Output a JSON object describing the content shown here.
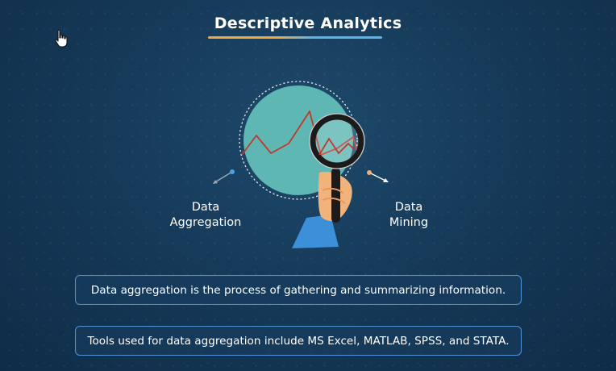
{
  "slide": {
    "title": "Descriptive Analytics",
    "label_left": "Data\nAggregation",
    "label_left_line1": "Data",
    "label_left_line2": "Aggregation",
    "label_right_line1": "Data",
    "label_right_line2": "Mining",
    "info_1": "Data aggregation is the process of gathering and summarizing information.",
    "info_2": "Tools used for data aggregation include MS Excel, MATLAB, SPSS, and STATA."
  },
  "icons": {
    "cursor": "hand-pointer-icon",
    "magnifier": "magnifying-glass-icon",
    "circle": "data-circle-icon"
  },
  "colors": {
    "background": "#163a59",
    "title_underline_left": "#f2a93b",
    "title_underline_right": "#5ab6e8",
    "circle_fill": "#5fb7b4",
    "trend_line": "#c0392b",
    "box_border": "#4b8fd4",
    "sleeve": "#3c8fd9",
    "hand": "#f2b27c"
  }
}
